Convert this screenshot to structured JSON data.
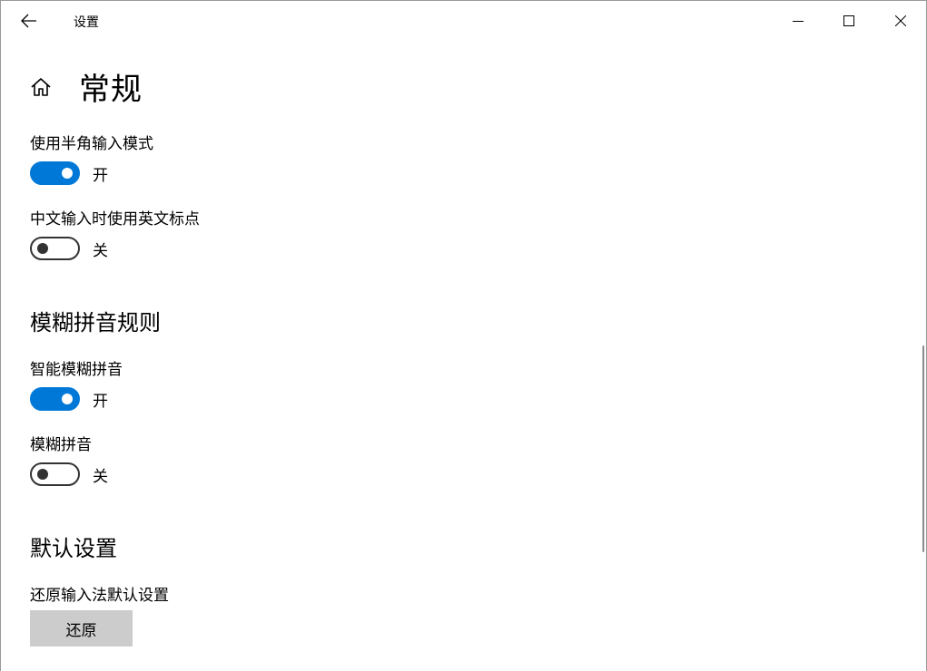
{
  "window": {
    "title": "设置",
    "controls": {
      "minimize_icon": "minimize-icon",
      "maximize_icon": "maximize-icon",
      "close_icon": "close-icon"
    }
  },
  "header": {
    "home_icon": "home-icon",
    "title": "常规"
  },
  "toggles": {
    "halfwidth": {
      "label": "使用半角输入模式",
      "state": "开",
      "on": true
    },
    "english_punct": {
      "label": "中文输入时使用英文标点",
      "state": "关",
      "on": false
    },
    "smart_fuzzy": {
      "label": "智能模糊拼音",
      "state": "开",
      "on": true
    },
    "fuzzy": {
      "label": "模糊拼音",
      "state": "关",
      "on": false
    }
  },
  "sections": {
    "fuzzy_rules": "模糊拼音规则",
    "defaults": "默认设置"
  },
  "defaults": {
    "reset_label": "还原输入法默认设置",
    "reset_button": "还原"
  },
  "colors": {
    "accent": "#0078d7",
    "button_bg": "#cccccc"
  }
}
